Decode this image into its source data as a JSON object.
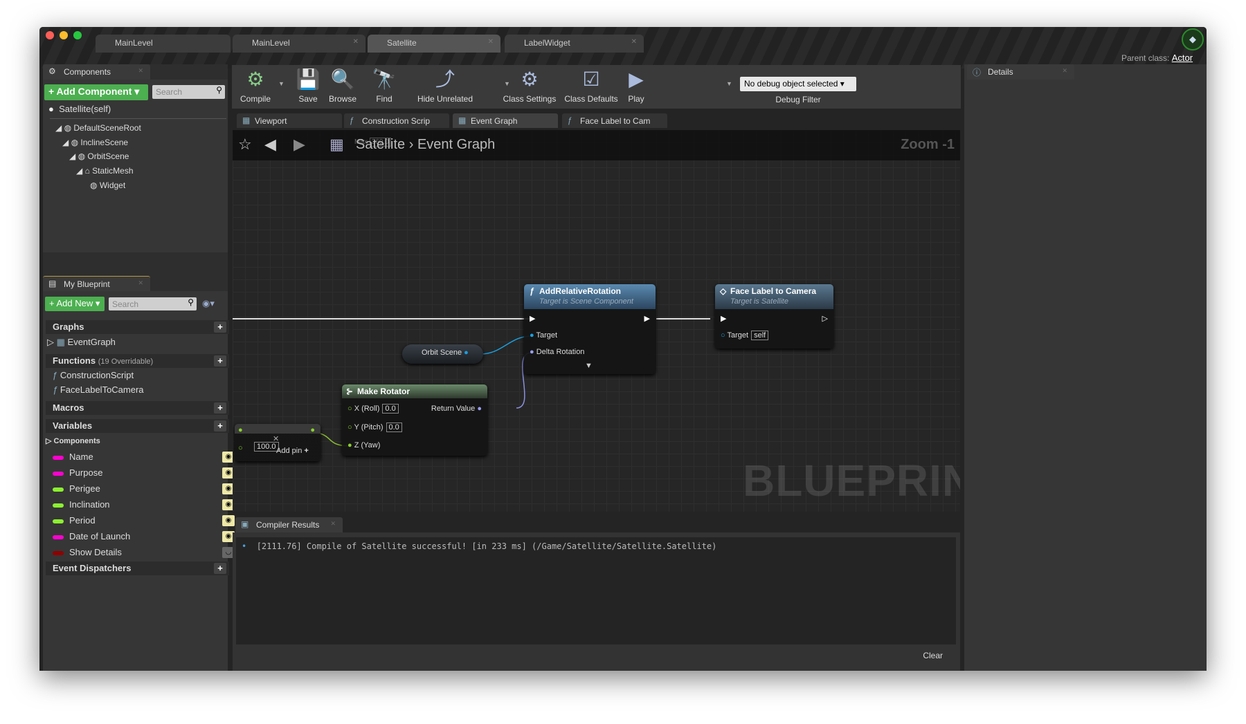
{
  "window": {
    "tabs": [
      {
        "label": "MainLevel",
        "active": false
      },
      {
        "label": "MainLevel",
        "active": false
      },
      {
        "label": "Satellite",
        "active": true
      },
      {
        "label": "LabelWidget",
        "active": false
      }
    ],
    "parent_class_label": "Parent class:",
    "parent_class_value": "Actor"
  },
  "components": {
    "tab": "Components",
    "add_button": "+ Add Component ▾",
    "search_placeholder": "Search",
    "root": "Satellite(self)",
    "tree": [
      "DefaultSceneRoot",
      "InclineScene",
      "OrbitScene",
      "StaticMesh",
      "Widget"
    ]
  },
  "my_blueprint": {
    "tab": "My Blueprint",
    "add_button": "+ Add New ▾",
    "search_placeholder": "Search",
    "graphs": {
      "label": "Graphs",
      "items": [
        "EventGraph"
      ]
    },
    "functions": {
      "label": "Functions",
      "note": "(19 Overridable)",
      "items": [
        "ConstructionScript",
        "FaceLabelToCamera"
      ]
    },
    "macros": {
      "label": "Macros"
    },
    "variables": {
      "label": "Variables",
      "category": "Components",
      "items": [
        {
          "name": "Name",
          "color": "#ff00d0",
          "visible": true
        },
        {
          "name": "Purpose",
          "color": "#ff00d0",
          "visible": true
        },
        {
          "name": "Perigee",
          "color": "#8cf030",
          "visible": true
        },
        {
          "name": "Inclination",
          "color": "#8cf030",
          "visible": true
        },
        {
          "name": "Period",
          "color": "#8cf030",
          "visible": true
        },
        {
          "name": "Date of Launch",
          "color": "#ff00d0",
          "visible": true
        },
        {
          "name": "Show Details",
          "color": "#900000",
          "visible": false
        }
      ]
    },
    "dispatchers": {
      "label": "Event Dispatchers"
    }
  },
  "toolbar": {
    "buttons": [
      {
        "label": "Compile",
        "icon": "compile-icon"
      },
      {
        "label": "Save",
        "icon": "save-icon"
      },
      {
        "label": "Browse",
        "icon": "browse-icon"
      },
      {
        "label": "Find",
        "icon": "find-icon"
      },
      {
        "label": "Hide Unrelated",
        "icon": "hide-unrelated-icon"
      },
      {
        "label": "Class Settings",
        "icon": "class-settings-icon"
      },
      {
        "label": "Class Defaults",
        "icon": "class-defaults-icon"
      },
      {
        "label": "Play",
        "icon": "play-icon"
      }
    ],
    "debug_select": "No debug object selected ▾",
    "debug_label": "Debug Filter"
  },
  "doc_tabs": [
    {
      "label": "Viewport"
    },
    {
      "label": "Construction Scrip"
    },
    {
      "label": "Event Graph",
      "active": true
    },
    {
      "label": "Face Label to Cam"
    }
  ],
  "graph": {
    "breadcrumb": [
      "Satellite",
      "Event Graph"
    ],
    "zoom": "Zoom -1",
    "watermark": "BLUEPRINT",
    "ghost_max": "Max",
    "ghost_value": "360.0",
    "nodes": {
      "add_rot": {
        "title": "AddRelativeRotation",
        "subtitle": "Target is Scene Component",
        "pins": [
          "Target",
          "Delta Rotation"
        ]
      },
      "face": {
        "title": "Face Label to Camera",
        "subtitle": "Target is Satellite",
        "pin": "Target",
        "pin_value": "self"
      },
      "orbit": {
        "label": "Orbit Scene"
      },
      "rotator": {
        "title": "Make Rotator",
        "pins": [
          {
            "label": "X (Roll)",
            "value": "0.0"
          },
          {
            "label": "Y (Pitch)",
            "value": "0.0"
          },
          {
            "label": "Z (Yaw)"
          }
        ],
        "output": "Return Value"
      },
      "math": {
        "value": "100.0",
        "add_pin": "Add pin"
      }
    }
  },
  "compiler": {
    "tab": "Compiler Results",
    "messages": [
      "[2111.76] Compile of Satellite successful! [in 233 ms] (/Game/Satellite/Satellite.Satellite)"
    ],
    "clear": "Clear"
  },
  "details": {
    "tab": "Details"
  }
}
